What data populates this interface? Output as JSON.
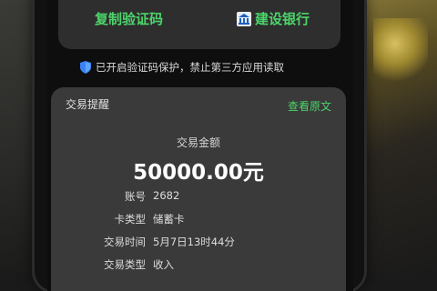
{
  "actions": {
    "copy_code": "复制验证码",
    "bank_name": "建设银行"
  },
  "notice": "已开启验证码保护，禁止第三方应用读取",
  "transaction": {
    "title": "交易提醒",
    "view_original": "查看原文",
    "amount_label": "交易金额",
    "amount": "50000.00元",
    "rows": [
      {
        "key": "账号",
        "value": "2682"
      },
      {
        "key": "卡类型",
        "value": "储蓄卡"
      },
      {
        "key": "交易时间",
        "value": "5月7日13时44分"
      },
      {
        "key": "交易类型",
        "value": "收入"
      }
    ]
  },
  "colors": {
    "accent": "#4cd56a",
    "card": "#3a3a3a",
    "shield": "#3b82f6"
  },
  "icons": [
    "bank-icon",
    "shield-icon"
  ]
}
